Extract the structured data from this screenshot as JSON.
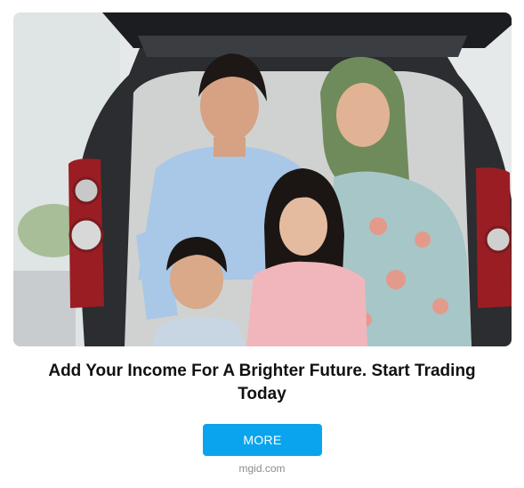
{
  "ad": {
    "image_alt": "Family of four smiling in front of an open car trunk",
    "headline": "Add Your Income For A Brighter Future. Start Trading Today",
    "button_label": "MORE",
    "source": "mgid.com"
  },
  "colors": {
    "button_bg": "#0aa4ee",
    "button_text": "#ffffff",
    "headline": "#111111",
    "source": "#8c8c8c"
  }
}
